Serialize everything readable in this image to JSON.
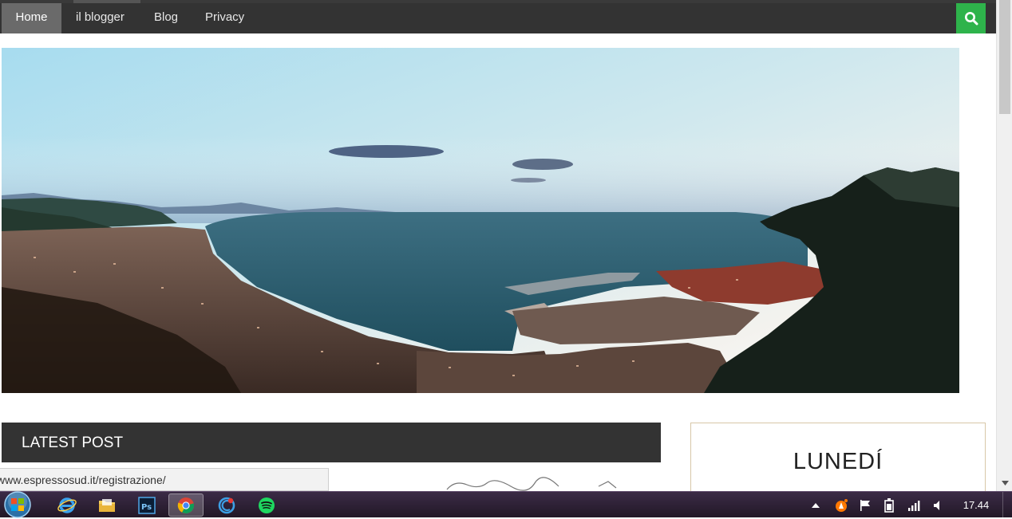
{
  "nav": {
    "items": [
      {
        "label": "Home",
        "active": true
      },
      {
        "label": "il blogger"
      },
      {
        "label": "Blog"
      },
      {
        "label": "Privacy"
      }
    ],
    "search_icon": "search-icon",
    "search_color": "#2eb34b"
  },
  "hero": {
    "image": "panoramic-bay-photo"
  },
  "latest": {
    "title": "LATEST POST"
  },
  "status_bar": {
    "url": "www.espressosud.it/registrazione/"
  },
  "widget": {
    "day": "LUNEDÍ"
  },
  "taskbar": {
    "apps": [
      {
        "name": "internet-explorer-icon"
      },
      {
        "name": "file-explorer-icon"
      },
      {
        "name": "photoshop-icon"
      },
      {
        "name": "chrome-icon",
        "active": true
      },
      {
        "name": "ccleaner-icon"
      },
      {
        "name": "spotify-icon"
      }
    ],
    "tray": [
      "show-hidden-icons",
      "avast-icon",
      "action-center-flag-icon",
      "power-icon",
      "network-icon",
      "volume-icon"
    ],
    "clock": "17.44"
  },
  "colors": {
    "nav_bg": "#333333",
    "nav_active": "#6a6a6a",
    "accent_green": "#2eb34b",
    "widget_border": "#d8c7a8"
  }
}
